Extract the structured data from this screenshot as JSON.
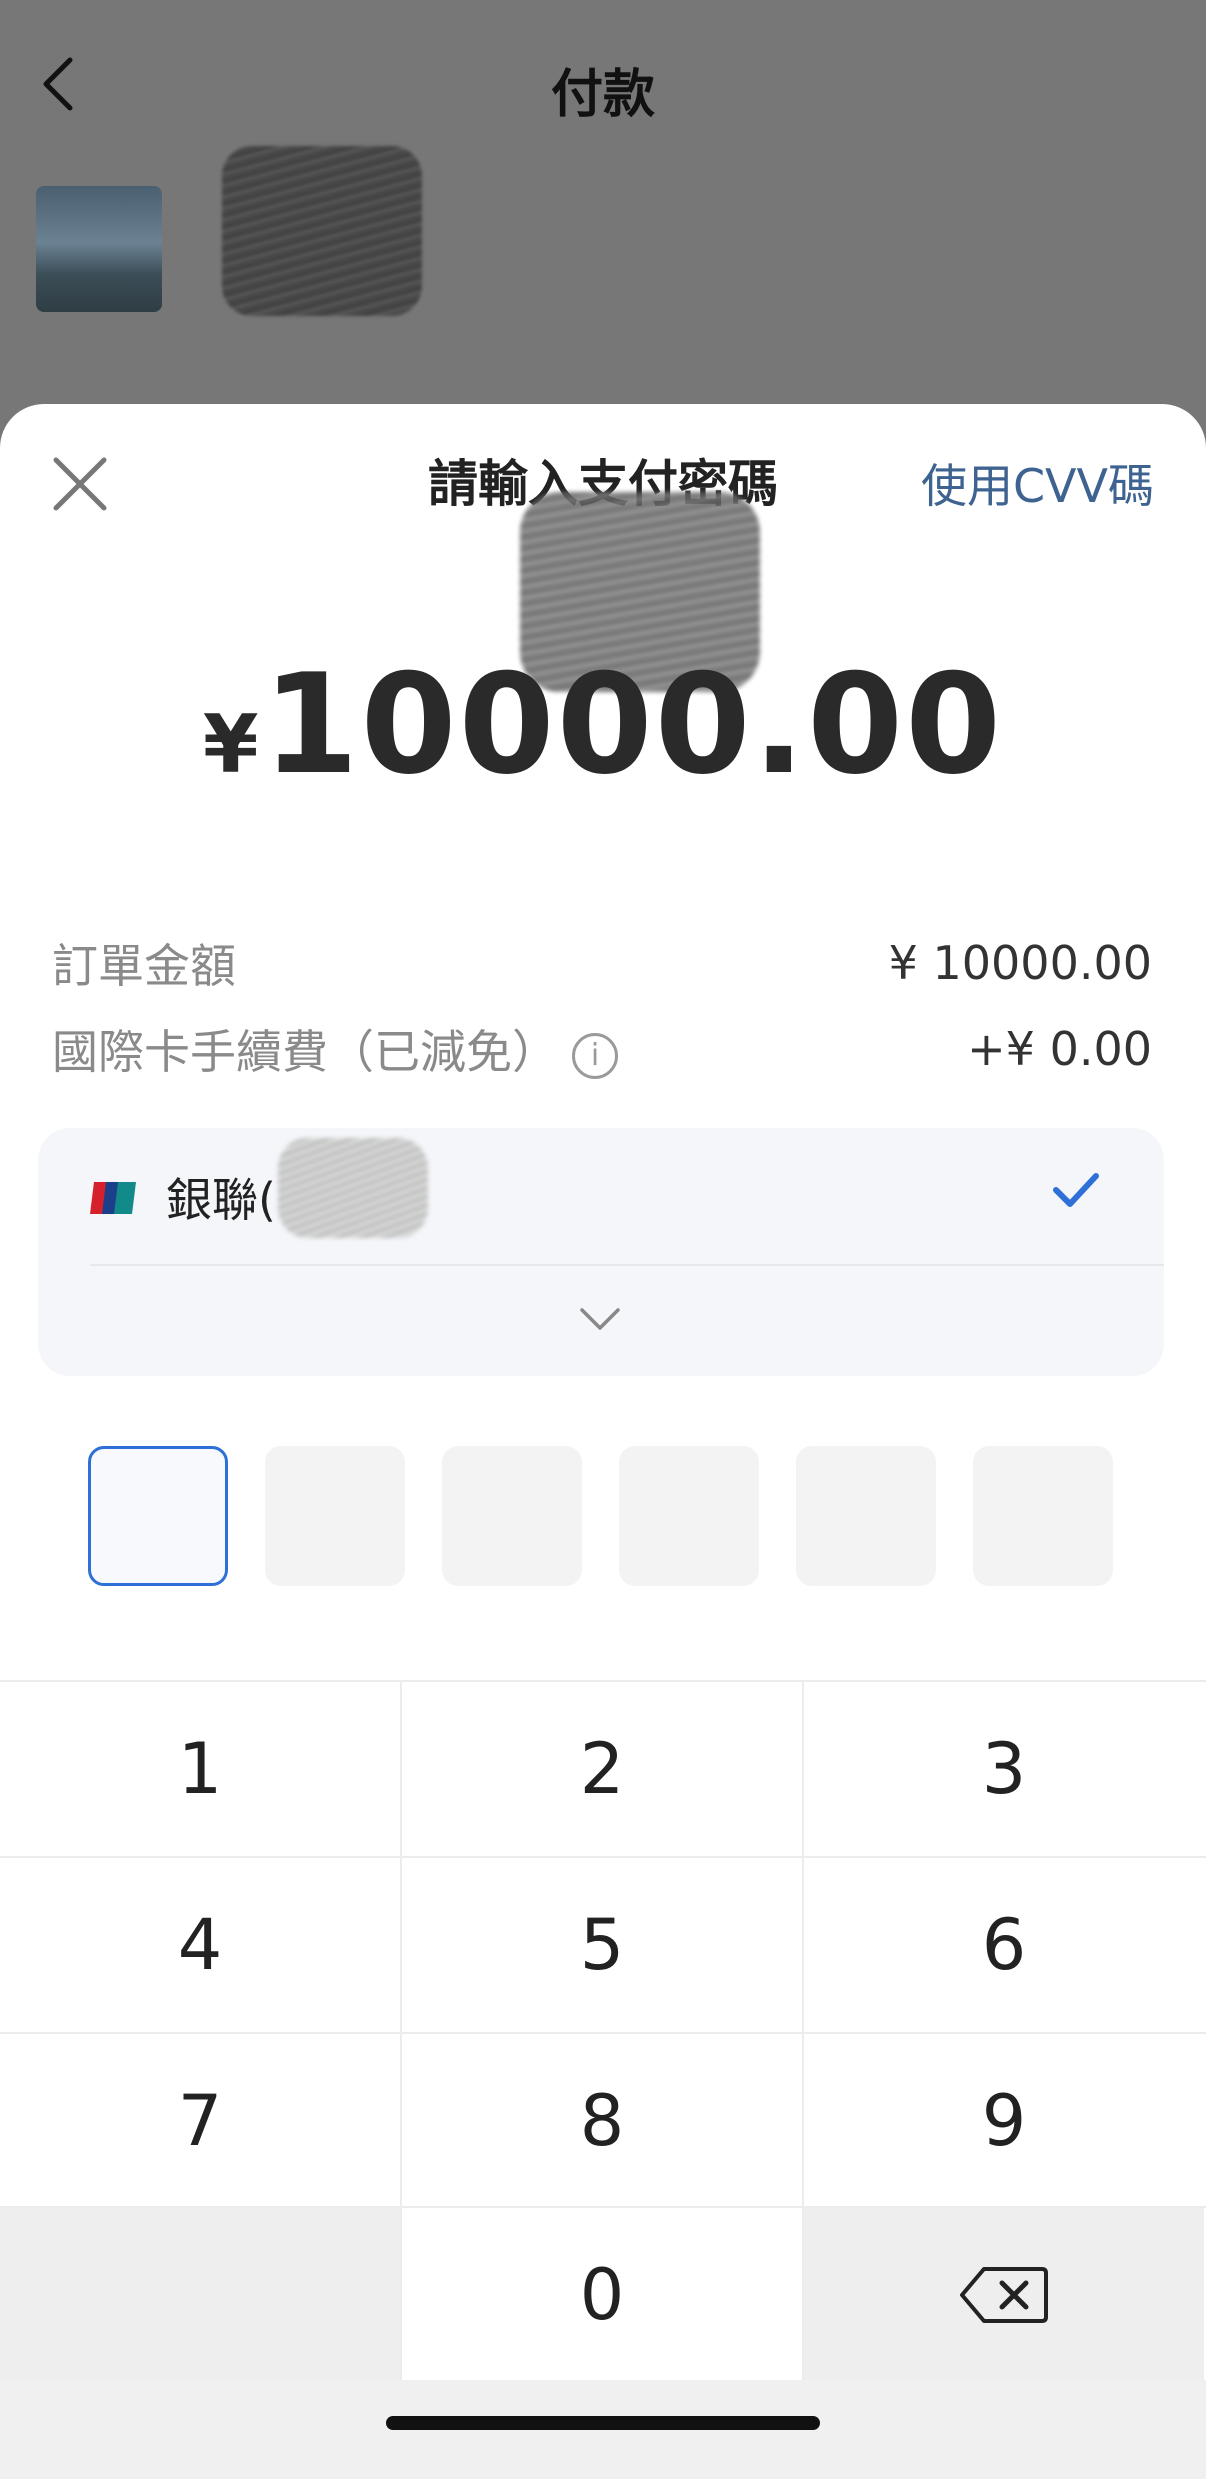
{
  "background": {
    "title": "付款"
  },
  "sheet": {
    "title": "請輸入支付密碼",
    "cvv_link": "使用CVV碼",
    "amount_currency": "¥",
    "amount_value": "10000.00"
  },
  "summary": {
    "order_label": "訂單金額",
    "order_value": "¥ 10000.00",
    "fee_label": "國際卡手續費（已減免）",
    "fee_value": "+¥ 0.00"
  },
  "card": {
    "label": "銀聯(",
    "selected": true
  },
  "pin": {
    "length": 6,
    "active_index": 0
  },
  "keypad": {
    "keys": [
      "1",
      "2",
      "3",
      "4",
      "5",
      "6",
      "7",
      "8",
      "9",
      "",
      "0",
      "delete"
    ]
  },
  "colors": {
    "accent": "#2f6fd8",
    "link": "#3f6390",
    "overlay": "#777777"
  }
}
